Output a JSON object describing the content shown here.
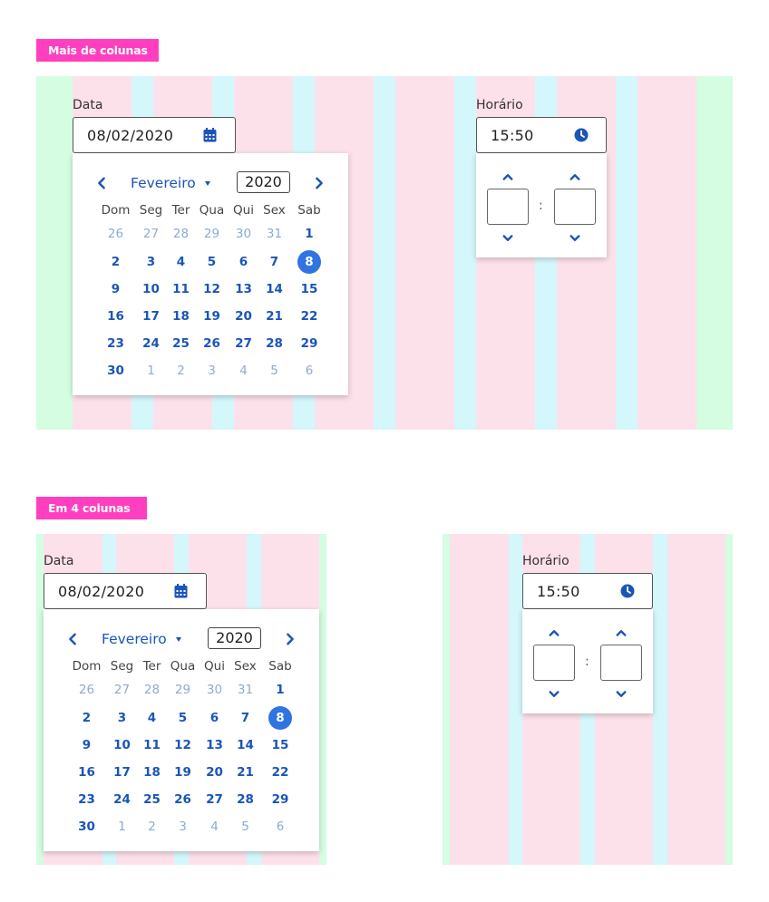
{
  "sections": [
    {
      "tag": "Mais de colunas"
    },
    {
      "tag": "Em 4 colunas"
    }
  ],
  "date_label": "Data",
  "date_value": "08/02/2020",
  "time_label": "Horário",
  "time_value": "15:50",
  "calendar": {
    "month": "Fevereiro",
    "year": "2020",
    "weekdays": [
      "Dom",
      "Seg",
      "Ter",
      "Qua",
      "Qui",
      "Sex",
      "Sab"
    ],
    "weeks": [
      [
        "26",
        "27",
        "28",
        "29",
        "30",
        "31",
        "1"
      ],
      [
        "2",
        "3",
        "4",
        "5",
        "6",
        "7",
        "8"
      ],
      [
        "9",
        "10",
        "11",
        "12",
        "13",
        "14",
        "15"
      ],
      [
        "16",
        "17",
        "18",
        "19",
        "20",
        "21",
        "22"
      ],
      [
        "23",
        "24",
        "25",
        "26",
        "27",
        "28",
        "29"
      ],
      [
        "30",
        "1",
        "2",
        "3",
        "4",
        "5",
        "6"
      ]
    ],
    "selected": "8",
    "time_separator": ":"
  },
  "colors": {
    "accent": "#1a55b7",
    "selected": "#2f74e0",
    "tag": "#ff3fbf",
    "column": "#fde1ea",
    "gutter": "#d4f7fc",
    "margin": "#d5fde1"
  },
  "icons": [
    "chevron-left-icon",
    "chevron-right-icon",
    "calendar-icon",
    "clock-icon",
    "chevron-up-icon",
    "chevron-down-icon"
  ]
}
